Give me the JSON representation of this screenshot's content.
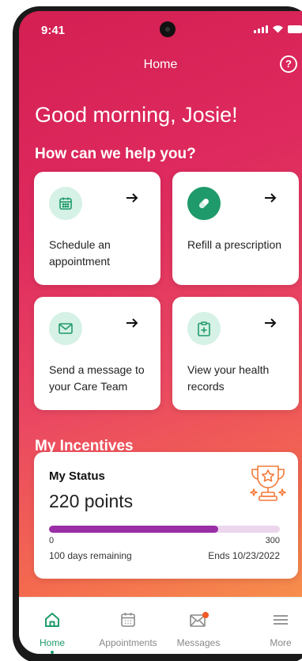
{
  "status_bar": {
    "time": "9:41"
  },
  "header": {
    "title": "Home",
    "help_glyph": "?"
  },
  "greeting": "Good morning, Josie!",
  "help_section_title": "How can we help you?",
  "actions": [
    {
      "label": "Schedule an appointment",
      "icon": "calendar-icon"
    },
    {
      "label": "Refill a prescription",
      "icon": "pill-icon"
    },
    {
      "label": "Send a message to your Care Team",
      "icon": "envelope-icon"
    },
    {
      "label": "View your health records",
      "icon": "clipboard-plus-icon"
    }
  ],
  "incentives": {
    "section_title": "My Incentives",
    "status_label": "My Status",
    "points": "220 points",
    "progress_min": "0",
    "progress_max": "300",
    "progress_value": 220,
    "days_remaining": "100 days remaining",
    "ends": "Ends 10/23/2022"
  },
  "tabs": [
    {
      "label": "Home",
      "icon": "home-icon",
      "active": true
    },
    {
      "label": "Appointments",
      "icon": "calendar-icon",
      "active": false
    },
    {
      "label": "Messages",
      "icon": "envelope-icon",
      "active": false,
      "badge": true
    },
    {
      "label": "More",
      "icon": "hamburger-icon",
      "active": false
    }
  ],
  "colors": {
    "accent_green": "#1f9a6a",
    "icon_bg_mint": "#d6f1e6",
    "progress_fill": "#9a2ea6",
    "progress_track": "#ecd6ee",
    "trophy_orange": "#f47a3a",
    "badge_orange": "#f05a28"
  }
}
